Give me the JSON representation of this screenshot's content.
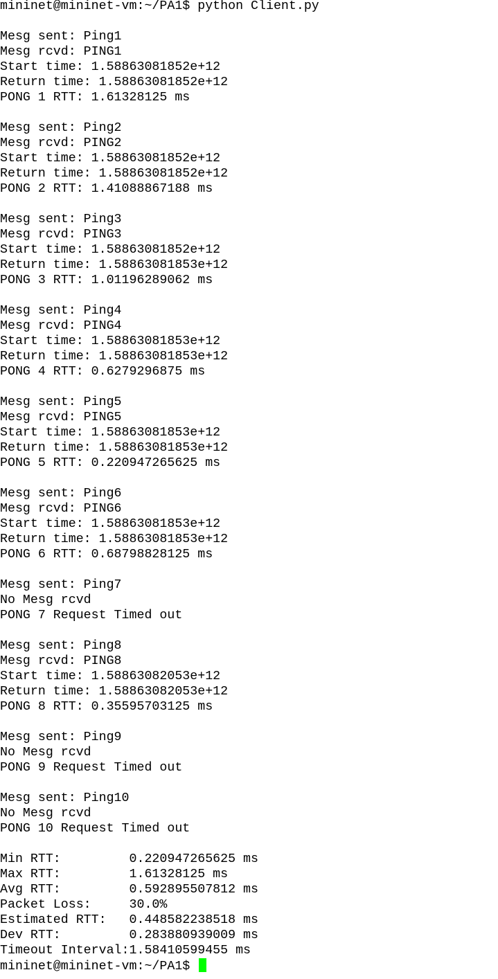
{
  "terminal": {
    "prompt": "mininet@mininet-vm:~/PA1$",
    "cursor_color": "#00ff00",
    "lines": [
      "mininet@mininet-vm:~/PA1$ python Client.py",
      "",
      "Mesg sent: Ping1",
      "Mesg rcvd: PING1",
      "Start time: 1.58863081852e+12",
      "Return time: 1.58863081852e+12",
      "PONG 1 RTT: 1.61328125 ms",
      "",
      "Mesg sent: Ping2",
      "Mesg rcvd: PING2",
      "Start time: 1.58863081852e+12",
      "Return time: 1.58863081852e+12",
      "PONG 2 RTT: 1.41088867188 ms",
      "",
      "Mesg sent: Ping3",
      "Mesg rcvd: PING3",
      "Start time: 1.58863081852e+12",
      "Return time: 1.58863081853e+12",
      "PONG 3 RTT: 1.01196289062 ms",
      "",
      "Mesg sent: Ping4",
      "Mesg rcvd: PING4",
      "Start time: 1.58863081853e+12",
      "Return time: 1.58863081853e+12",
      "PONG 4 RTT: 0.6279296875 ms",
      "",
      "Mesg sent: Ping5",
      "Mesg rcvd: PING5",
      "Start time: 1.58863081853e+12",
      "Return time: 1.58863081853e+12",
      "PONG 5 RTT: 0.220947265625 ms",
      "",
      "Mesg sent: Ping6",
      "Mesg rcvd: PING6",
      "Start time: 1.58863081853e+12",
      "Return time: 1.58863081853e+12",
      "PONG 6 RTT: 0.68798828125 ms",
      "",
      "Mesg sent: Ping7",
      "No Mesg rcvd",
      "PONG 7 Request Timed out",
      "",
      "Mesg sent: Ping8",
      "Mesg rcvd: PING8",
      "Start time: 1.58863082053e+12",
      "Return time: 1.58863082053e+12",
      "PONG 8 RTT: 0.35595703125 ms",
      "",
      "Mesg sent: Ping9",
      "No Mesg rcvd",
      "PONG 9 Request Timed out",
      "",
      "Mesg sent: Ping10",
      "No Mesg rcvd",
      "PONG 10 Request Timed out",
      "",
      "Min RTT:         0.220947265625 ms",
      "Max RTT:         1.61328125 ms",
      "Avg RTT:         0.592895507812 ms",
      "Packet Loss:     30.0%",
      "Estimated RTT:   0.448582238518 ms",
      "Dev RTT:         0.283880939009 ms",
      "Timeout Interval:1.58410599455 ms"
    ]
  }
}
